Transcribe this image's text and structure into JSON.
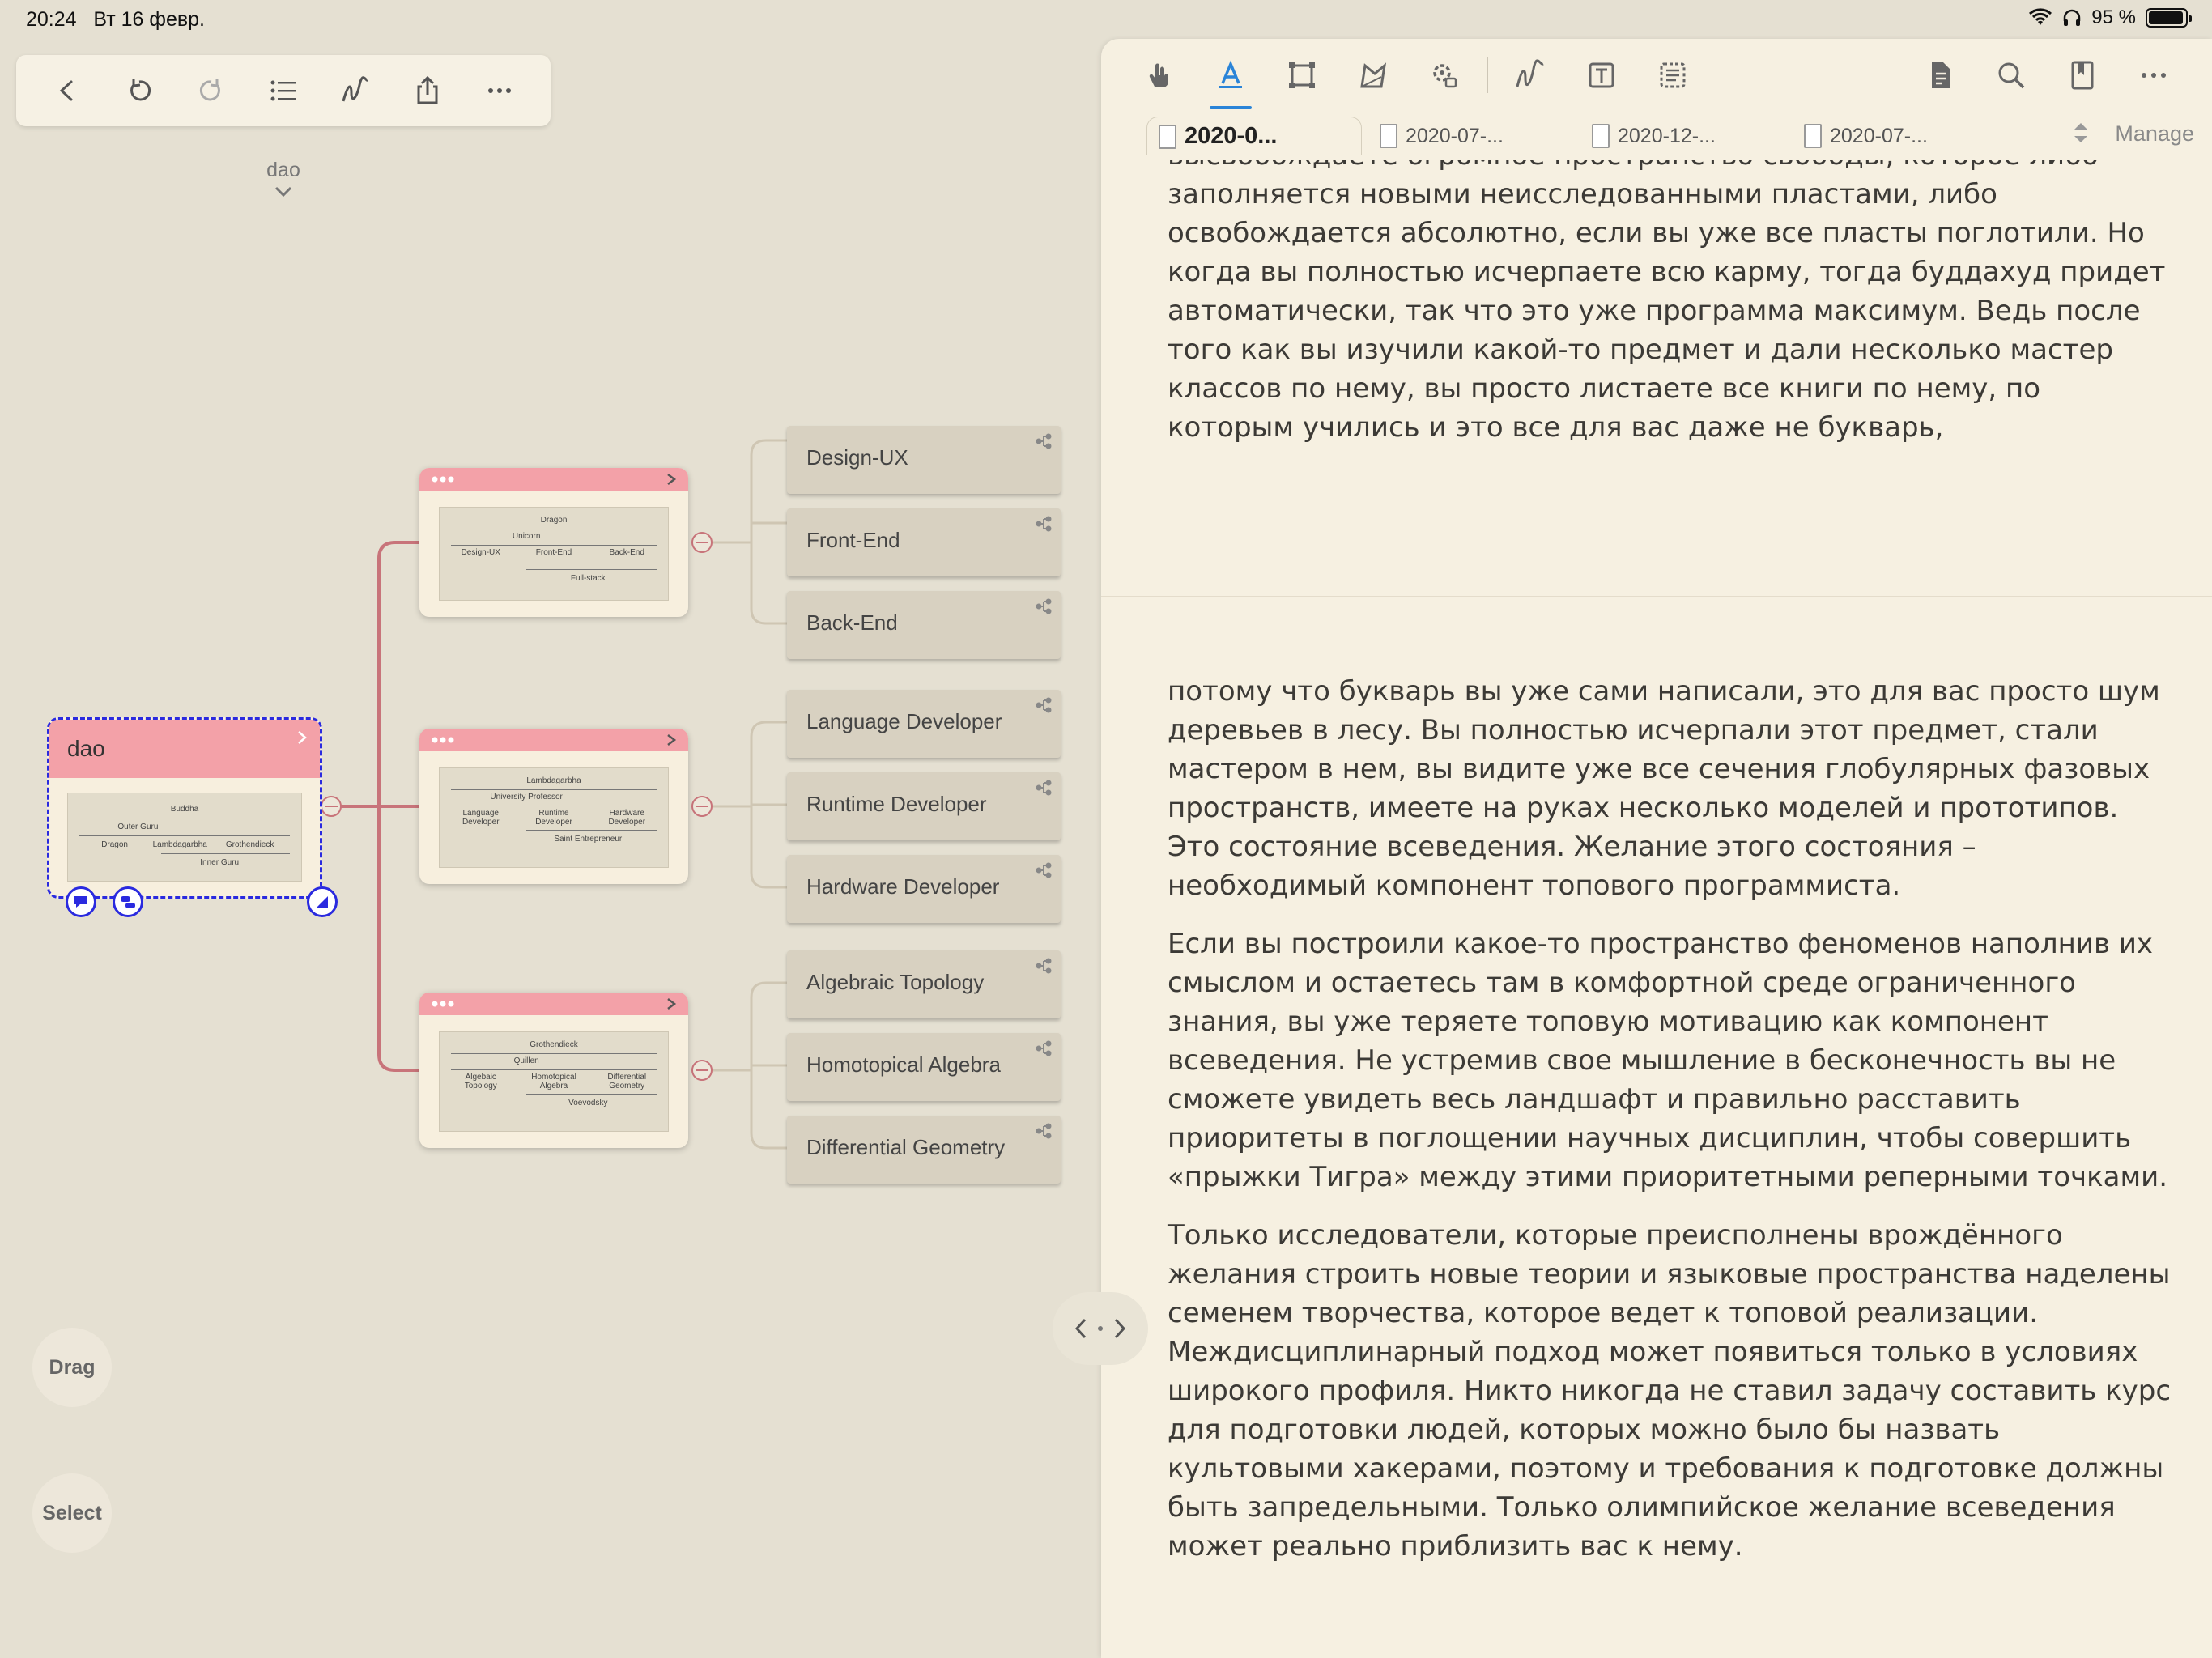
{
  "status": {
    "time": "20:24",
    "date": "Вт 16 февр.",
    "battery_text": "95 %",
    "battery_level": 0.95
  },
  "left_toolbar": {
    "icons": [
      "back-icon",
      "undo-icon",
      "redo-icon",
      "outline-list-icon",
      "pen-squiggle-icon",
      "share-icon",
      "more-icon"
    ]
  },
  "breadcrumb": {
    "label": "dao"
  },
  "root": {
    "title": "dao",
    "thumbnail": {
      "top": "Buddha",
      "mid": "Outer Guru",
      "items": [
        "Dragon",
        "Lambdagarbha",
        "Grothendieck"
      ],
      "bottom": "Inner Guru"
    }
  },
  "groups": [
    {
      "thumbnail": {
        "top": "Dragon",
        "mid": "Unicorn",
        "items": [
          "Design-UX",
          "Front-End",
          "Back-End"
        ],
        "bottom": "Full-stack"
      },
      "leaves": [
        "Design-UX",
        "Front-End",
        "Back-End"
      ]
    },
    {
      "thumbnail": {
        "top": "Lambdagarbha",
        "mid": "University Professor",
        "items": [
          "Language Developer",
          "Runtime Developer",
          "Hardware Developer"
        ],
        "bottom": "Saint Entrepreneur"
      },
      "leaves": [
        "Language Developer",
        "Runtime Developer",
        "Hardware Developer"
      ]
    },
    {
      "thumbnail": {
        "top": "Grothendieck",
        "mid": "Quillen",
        "items": [
          "Algebaic Topology",
          "Homotopical Algebra",
          "Differential Geometry"
        ],
        "bottom": "Voevodsky"
      },
      "leaves": [
        "Algebraic Topology",
        "Homotopical Algebra",
        "Differential Geometry"
      ]
    }
  ],
  "fabs": {
    "drag": "Drag",
    "select": "Select"
  },
  "right_toolbar": {
    "icons": [
      "hand-icon",
      "text-highlight-icon",
      "rectangle-select-icon",
      "lasso-icon",
      "settings-gear-icon",
      "pen-squiggle-icon",
      "text-box-icon",
      "text-select-icon",
      "document-icon",
      "search-icon",
      "bookmark-icon",
      "more-icon"
    ],
    "active": "text-highlight-icon"
  },
  "tabs": [
    {
      "label": "2020-0...",
      "active": true
    },
    {
      "label": "2020-07-...",
      "active": false
    },
    {
      "label": "2020-12-...",
      "active": false
    },
    {
      "label": "2020-07-...",
      "active": false
    }
  ],
  "manage_label": "Manage",
  "reader": {
    "top_paragraph": "высвобождаете огромное пространство свободы, которое либо заполняется новыми неисследованными пластами, либо освобождается абсолютно, если вы уже все пласты поглотили. Но когда вы полностью исчерпаете всю карму, тогда буддахуд придет автоматически, так что это уже программа максимум. Ведь после того как вы изучили какой-то предмет и дали несколько мастер классов по нему, вы просто листаете все книги по нему, по которым учились и это все для вас даже не букварь,",
    "paragraphs": [
      "потому что букварь вы уже сами написали, это для вас просто шум деревьев в лесу. Вы полностью исчерпали этот предмет, стали мастером в нем, вы видите уже все сечения глобулярных фазовых пространств, имеете на руках несколько моделей и прототипов. Это состояние всеведения. Желание этого состояния – необходимый компонент топового программиста.",
      "Если вы построили какое-то пространство феноменов наполнив их смыслом и остаетесь там в комфортной среде ограниченного знания, вы уже теряете топовую мотивацию как компонент всеведения. Не устремив свое мышление в бесконечность вы не сможете увидеть весь ландшафт и правильно расставить приоритеты в поглощении научных дисциплин, чтобы совершить «прыжки Тигра» между этими приоритетными реперными точками.",
      "Только исследователи, которые преисполнены врождённого желания строить новые теории и языковые пространства наделены семенем творчества, которое ведет к топовой реализации. Междисциплинарный подход может появиться только в условиях широкого профиля. Никто никогда не ставил задачу составить курс для подготовки людей, которых можно было бы назвать культовыми хакерами, поэтому и требования к подготовке должны быть запредельными. Только олимпийское желание всеведения может реально приблизить вас к нему."
    ]
  },
  "colors": {
    "accent": "#2a84d8",
    "card_header": "#f3a1a8",
    "connector": "#c8747a",
    "selection": "#2a2adf",
    "canvas": "#e5e0d2",
    "panel": "#f6f0e1"
  }
}
